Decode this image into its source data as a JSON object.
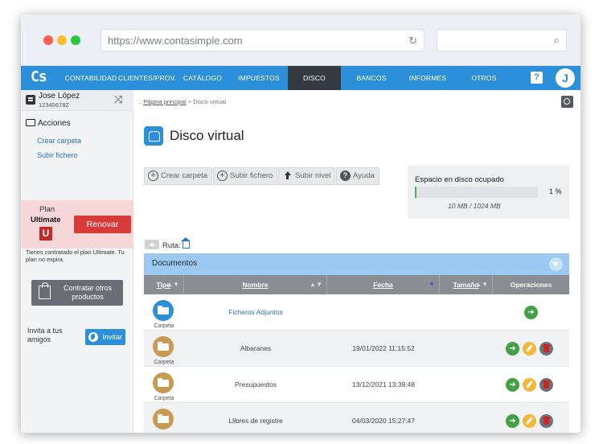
{
  "browser": {
    "url": "https://www.contasimple.com"
  },
  "nav": {
    "logo": "Cs",
    "items": [
      {
        "label": "CONTABILIDAD"
      },
      {
        "label": "CLIENTES/PROV."
      },
      {
        "label": "CATÁLOGO"
      },
      {
        "label": "IMPUESTOS"
      },
      {
        "label": "DISCO VIRTUAL"
      },
      {
        "label": "BANCOS"
      },
      {
        "label": "INFORMES"
      },
      {
        "label": "OTROS"
      }
    ],
    "active_index": 4,
    "help_label": "?",
    "user_initial": "J"
  },
  "sidebar": {
    "user_name": "Jose López",
    "user_nif": "12345678Z",
    "acciones_title": "Acciones",
    "links": [
      {
        "label": "Crear carpeta"
      },
      {
        "label": "Subir fichero"
      }
    ],
    "plan": {
      "label": "Plan",
      "name": "Ultimate",
      "badge": "U",
      "renew_label": "Renovar"
    },
    "plan_info": "Tienes contratado el plan Ultimate. Tu plan no expira.",
    "contratar_label": "Contratar otros productos",
    "invita_text": "Invita a tus amigos",
    "invitar_label": "Invitar"
  },
  "main": {
    "breadcrumb_prefix": ":: ",
    "breadcrumb_home": "Página principal",
    "breadcrumb_current": " > Disco virtual",
    "title": "Disco virtual",
    "toolbar": [
      {
        "label": "Crear carpeta",
        "icon": "plus-circle-icon"
      },
      {
        "label": "Subir fichero",
        "icon": "plus-circle-icon"
      },
      {
        "label": "Subir nivel",
        "icon": "arrow-up-icon"
      },
      {
        "label": "Ayuda",
        "icon": "question-icon"
      }
    ],
    "space": {
      "title": "Espacio en disco ocupado",
      "percent_label": "1 %",
      "fill_fraction": 0.01,
      "used_label": "10 MB / 1024 MB"
    },
    "ruta_label": "Ruta:",
    "documents": {
      "title": "Documentos",
      "columns": [
        "Tipo",
        "Nombre",
        "Fecha",
        "Tamaño",
        "Operaciones"
      ],
      "rows": [
        {
          "type": "Carpeta",
          "name": "Ficheros Adjuntos",
          "date": "",
          "size": "",
          "color": "#2b8fd9",
          "link": true,
          "ops": [
            "go"
          ]
        },
        {
          "type": "Carpeta",
          "name": "Albaranes",
          "date": "19/01/2022 11:15:52",
          "size": "",
          "color": "#c99a52",
          "link": false,
          "ops": [
            "go",
            "edit",
            "del"
          ]
        },
        {
          "type": "Carpeta",
          "name": "Presupuestos",
          "date": "13/12/2021 13:39:48",
          "size": "",
          "color": "#c99a52",
          "link": false,
          "ops": [
            "go",
            "edit",
            "del"
          ]
        },
        {
          "type": "",
          "name": "Llibres de registre",
          "date": "04/03/2020 15:27:47",
          "size": "",
          "color": "#c99a52",
          "link": false,
          "ops": [
            "go",
            "edit",
            "del"
          ]
        }
      ]
    }
  }
}
